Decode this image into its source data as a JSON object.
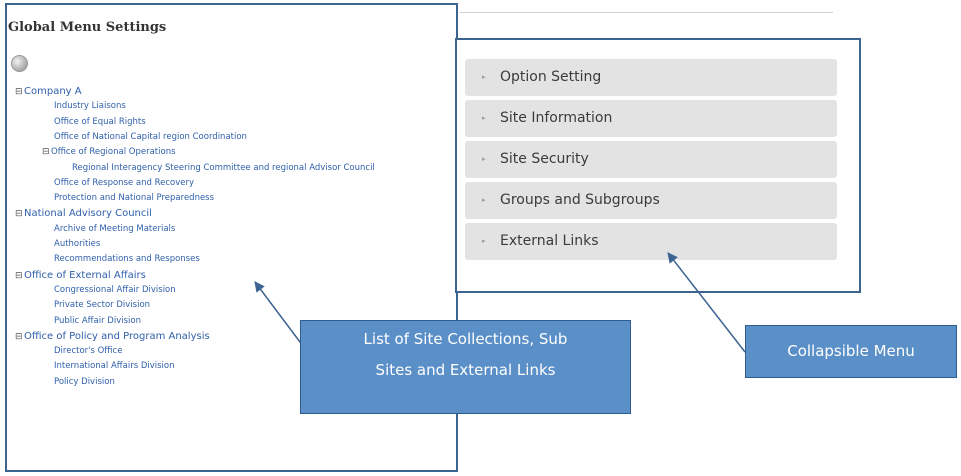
{
  "left_panel": {
    "title": "Global Menu Settings",
    "tree": [
      {
        "label": "Company A",
        "toggle": "⊟",
        "level": 0
      },
      {
        "label": "Industry Liaisons",
        "toggle": "",
        "level": 1
      },
      {
        "label": "Office of Equal Rights",
        "toggle": "",
        "level": 1
      },
      {
        "label": "Office of National Capital region Coordination",
        "toggle": "",
        "level": 1
      },
      {
        "label": "Office of Regional Operations",
        "toggle": "⊟",
        "level": 1
      },
      {
        "label": "Regional Interagency Steering Committee and regional Advisor Council",
        "toggle": "",
        "level": 2
      },
      {
        "label": "Office of Response and Recovery",
        "toggle": "",
        "level": 1
      },
      {
        "label": "Protection and National Preparedness",
        "toggle": "",
        "level": 1
      },
      {
        "label": "National Advisory Council",
        "toggle": "⊟",
        "level": 0
      },
      {
        "label": "Archive of Meeting Materials",
        "toggle": "",
        "level": 1
      },
      {
        "label": "Authorities",
        "toggle": "",
        "level": 1
      },
      {
        "label": "Recommendations and Responses",
        "toggle": "",
        "level": 1
      },
      {
        "label": "Office of External Affairs",
        "toggle": "⊟",
        "level": 0
      },
      {
        "label": "Congressional Affair Division",
        "toggle": "",
        "level": 1
      },
      {
        "label": "Private Sector Division",
        "toggle": "",
        "level": 1
      },
      {
        "label": "Public Affair Division",
        "toggle": "",
        "level": 1
      },
      {
        "label": "Office of Policy and Program Analysis",
        "toggle": "⊟",
        "level": 0
      },
      {
        "label": "Director's Office",
        "toggle": "",
        "level": 1
      },
      {
        "label": "International Affairs Division",
        "toggle": "",
        "level": 1
      },
      {
        "label": "Policy Division",
        "toggle": "",
        "level": 1
      }
    ]
  },
  "collapsible_menu": {
    "items": [
      {
        "label": "Option Setting",
        "chevron": "▸"
      },
      {
        "label": "Site Information",
        "chevron": "▸"
      },
      {
        "label": "Site Security",
        "chevron": "▸"
      },
      {
        "label": "Groups and Subgroups",
        "chevron": "▸"
      },
      {
        "label": "External Links",
        "chevron": "▸"
      }
    ]
  },
  "callouts": {
    "list_line1": "List of Site Collections, Sub",
    "list_line2": "Sites and External Links",
    "collapsible": "Collapsible Menu"
  },
  "colors": {
    "panel_border": "#3d6391",
    "callout_fill": "#5b8fc8",
    "link_blue": "#2f5faa",
    "menu_bg": "#e3e3e3"
  }
}
